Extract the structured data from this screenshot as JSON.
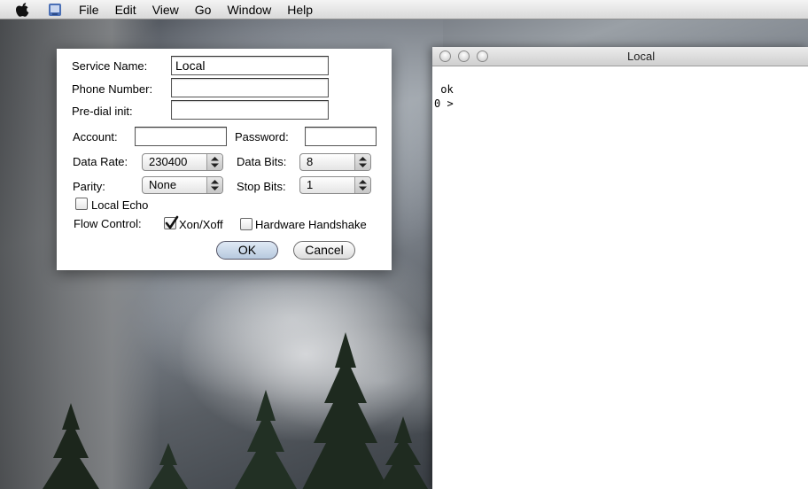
{
  "menubar": {
    "apple_icon": "apple-logo-icon",
    "app_icon": "application-icon",
    "items": [
      "File",
      "Edit",
      "View",
      "Go",
      "Window",
      "Help"
    ]
  },
  "dialog": {
    "service_name": {
      "label": "Service Name:",
      "value": "Local"
    },
    "phone_number": {
      "label": "Phone Number:",
      "value": ""
    },
    "predial_init": {
      "label": "Pre-dial init:",
      "value": ""
    },
    "account": {
      "label": "Account:",
      "value": ""
    },
    "password": {
      "label": "Password:",
      "value": ""
    },
    "data_rate": {
      "label": "Data Rate:",
      "selected": "230400"
    },
    "data_bits": {
      "label": "Data Bits:",
      "selected": "8"
    },
    "parity": {
      "label": "Parity:",
      "selected": "None"
    },
    "stop_bits": {
      "label": "Stop Bits:",
      "selected": "1"
    },
    "local_echo": {
      "label": "Local Echo",
      "checked": false
    },
    "flow_control": {
      "label": "Flow Control:",
      "xon_xoff": {
        "label": "Xon/Xoff",
        "checked": true
      },
      "hardware": {
        "label": "Hardware Handshake",
        "checked": false
      }
    },
    "ok_label": "OK",
    "cancel_label": "Cancel"
  },
  "terminal": {
    "title": "Local",
    "lines": [
      " ok",
      "0 >"
    ]
  }
}
